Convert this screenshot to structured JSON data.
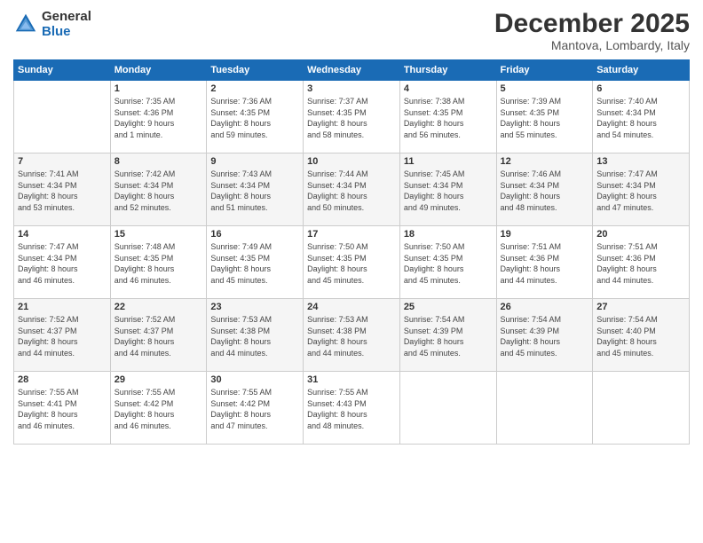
{
  "header": {
    "logo_line1": "General",
    "logo_line2": "Blue",
    "month": "December 2025",
    "location": "Mantova, Lombardy, Italy"
  },
  "days_of_week": [
    "Sunday",
    "Monday",
    "Tuesday",
    "Wednesday",
    "Thursday",
    "Friday",
    "Saturday"
  ],
  "weeks": [
    [
      {
        "day": "",
        "detail": ""
      },
      {
        "day": "1",
        "detail": "Sunrise: 7:35 AM\nSunset: 4:36 PM\nDaylight: 9 hours\nand 1 minute."
      },
      {
        "day": "2",
        "detail": "Sunrise: 7:36 AM\nSunset: 4:35 PM\nDaylight: 8 hours\nand 59 minutes."
      },
      {
        "day": "3",
        "detail": "Sunrise: 7:37 AM\nSunset: 4:35 PM\nDaylight: 8 hours\nand 58 minutes."
      },
      {
        "day": "4",
        "detail": "Sunrise: 7:38 AM\nSunset: 4:35 PM\nDaylight: 8 hours\nand 56 minutes."
      },
      {
        "day": "5",
        "detail": "Sunrise: 7:39 AM\nSunset: 4:35 PM\nDaylight: 8 hours\nand 55 minutes."
      },
      {
        "day": "6",
        "detail": "Sunrise: 7:40 AM\nSunset: 4:34 PM\nDaylight: 8 hours\nand 54 minutes."
      }
    ],
    [
      {
        "day": "7",
        "detail": "Sunrise: 7:41 AM\nSunset: 4:34 PM\nDaylight: 8 hours\nand 53 minutes."
      },
      {
        "day": "8",
        "detail": "Sunrise: 7:42 AM\nSunset: 4:34 PM\nDaylight: 8 hours\nand 52 minutes."
      },
      {
        "day": "9",
        "detail": "Sunrise: 7:43 AM\nSunset: 4:34 PM\nDaylight: 8 hours\nand 51 minutes."
      },
      {
        "day": "10",
        "detail": "Sunrise: 7:44 AM\nSunset: 4:34 PM\nDaylight: 8 hours\nand 50 minutes."
      },
      {
        "day": "11",
        "detail": "Sunrise: 7:45 AM\nSunset: 4:34 PM\nDaylight: 8 hours\nand 49 minutes."
      },
      {
        "day": "12",
        "detail": "Sunrise: 7:46 AM\nSunset: 4:34 PM\nDaylight: 8 hours\nand 48 minutes."
      },
      {
        "day": "13",
        "detail": "Sunrise: 7:47 AM\nSunset: 4:34 PM\nDaylight: 8 hours\nand 47 minutes."
      }
    ],
    [
      {
        "day": "14",
        "detail": "Sunrise: 7:47 AM\nSunset: 4:34 PM\nDaylight: 8 hours\nand 46 minutes."
      },
      {
        "day": "15",
        "detail": "Sunrise: 7:48 AM\nSunset: 4:35 PM\nDaylight: 8 hours\nand 46 minutes."
      },
      {
        "day": "16",
        "detail": "Sunrise: 7:49 AM\nSunset: 4:35 PM\nDaylight: 8 hours\nand 45 minutes."
      },
      {
        "day": "17",
        "detail": "Sunrise: 7:50 AM\nSunset: 4:35 PM\nDaylight: 8 hours\nand 45 minutes."
      },
      {
        "day": "18",
        "detail": "Sunrise: 7:50 AM\nSunset: 4:35 PM\nDaylight: 8 hours\nand 45 minutes."
      },
      {
        "day": "19",
        "detail": "Sunrise: 7:51 AM\nSunset: 4:36 PM\nDaylight: 8 hours\nand 44 minutes."
      },
      {
        "day": "20",
        "detail": "Sunrise: 7:51 AM\nSunset: 4:36 PM\nDaylight: 8 hours\nand 44 minutes."
      }
    ],
    [
      {
        "day": "21",
        "detail": "Sunrise: 7:52 AM\nSunset: 4:37 PM\nDaylight: 8 hours\nand 44 minutes."
      },
      {
        "day": "22",
        "detail": "Sunrise: 7:52 AM\nSunset: 4:37 PM\nDaylight: 8 hours\nand 44 minutes."
      },
      {
        "day": "23",
        "detail": "Sunrise: 7:53 AM\nSunset: 4:38 PM\nDaylight: 8 hours\nand 44 minutes."
      },
      {
        "day": "24",
        "detail": "Sunrise: 7:53 AM\nSunset: 4:38 PM\nDaylight: 8 hours\nand 44 minutes."
      },
      {
        "day": "25",
        "detail": "Sunrise: 7:54 AM\nSunset: 4:39 PM\nDaylight: 8 hours\nand 45 minutes."
      },
      {
        "day": "26",
        "detail": "Sunrise: 7:54 AM\nSunset: 4:39 PM\nDaylight: 8 hours\nand 45 minutes."
      },
      {
        "day": "27",
        "detail": "Sunrise: 7:54 AM\nSunset: 4:40 PM\nDaylight: 8 hours\nand 45 minutes."
      }
    ],
    [
      {
        "day": "28",
        "detail": "Sunrise: 7:55 AM\nSunset: 4:41 PM\nDaylight: 8 hours\nand 46 minutes."
      },
      {
        "day": "29",
        "detail": "Sunrise: 7:55 AM\nSunset: 4:42 PM\nDaylight: 8 hours\nand 46 minutes."
      },
      {
        "day": "30",
        "detail": "Sunrise: 7:55 AM\nSunset: 4:42 PM\nDaylight: 8 hours\nand 47 minutes."
      },
      {
        "day": "31",
        "detail": "Sunrise: 7:55 AM\nSunset: 4:43 PM\nDaylight: 8 hours\nand 48 minutes."
      },
      {
        "day": "",
        "detail": ""
      },
      {
        "day": "",
        "detail": ""
      },
      {
        "day": "",
        "detail": ""
      }
    ]
  ]
}
